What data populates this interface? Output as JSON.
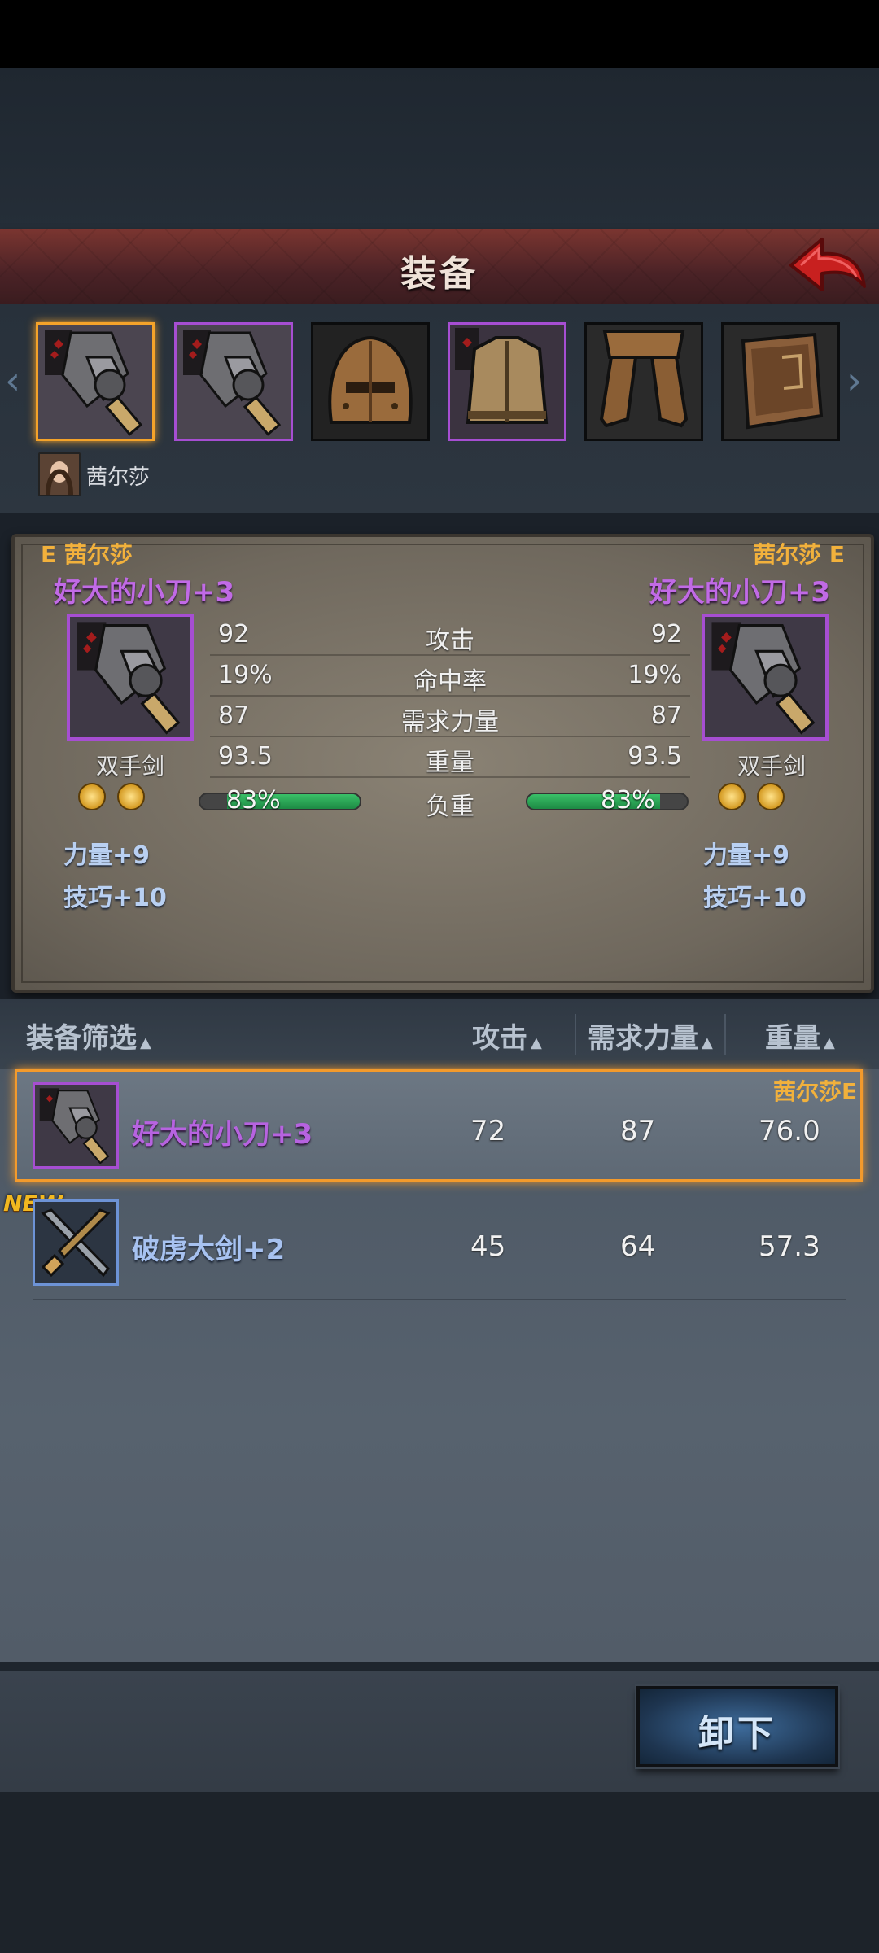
{
  "header": {
    "title": "装备"
  },
  "character": {
    "name": "茜尔莎"
  },
  "slots": [
    {
      "name": "weapon-main",
      "icon": "greatsword-icon",
      "border": "gold"
    },
    {
      "name": "weapon-offhand",
      "icon": "greatsword-icon",
      "border": "purple"
    },
    {
      "name": "helmet",
      "icon": "helmet-icon",
      "border": "none"
    },
    {
      "name": "armor",
      "icon": "chest-armor-icon",
      "border": "purple"
    },
    {
      "name": "legs",
      "icon": "greaves-icon",
      "border": "none"
    },
    {
      "name": "accessory",
      "icon": "book-icon",
      "border": "none"
    }
  ],
  "compare": {
    "left": {
      "owner_tag": "E 茜尔莎",
      "item_name": "好大的小刀+3",
      "type": "双手剑",
      "attack": "92",
      "hit_rate": "19%",
      "req_strength": "87",
      "weight": "93.5",
      "load_text": "83%",
      "load_fraction": 0.83,
      "bonus_1": "力量+9",
      "bonus_2": "技巧+10"
    },
    "right": {
      "owner_tag": "茜尔莎 E",
      "item_name": "好大的小刀+3",
      "type": "双手剑",
      "attack": "92",
      "hit_rate": "19%",
      "req_strength": "87",
      "weight": "93.5",
      "load_text": "83%",
      "load_fraction": 0.83,
      "bonus_1": "力量+9",
      "bonus_2": "技巧+10"
    },
    "labels": {
      "attack": "攻击",
      "hit_rate": "命中率",
      "req_strength": "需求力量",
      "weight": "重量",
      "load": "负重"
    }
  },
  "list": {
    "headers": {
      "filter": "装备筛选",
      "attack": "攻击",
      "req_strength": "需求力量",
      "weight": "重量"
    },
    "items": [
      {
        "name": "好大的小刀+3",
        "attack": "72",
        "req_strength": "87",
        "weight": "76.0",
        "owner_tag": "茜尔莎E",
        "selected": true
      },
      {
        "name": "破虏大剑+2",
        "attack": "45",
        "req_strength": "64",
        "weight": "57.3",
        "badge": "NEW",
        "selected": false
      }
    ]
  },
  "footer": {
    "unequip_label": "卸下"
  },
  "colors": {
    "rare_purple": "#a64ed2",
    "selected_orange": "#f39a2c",
    "owner_gold": "#f2b13c",
    "uncommon_blue": "#6d93d6"
  }
}
